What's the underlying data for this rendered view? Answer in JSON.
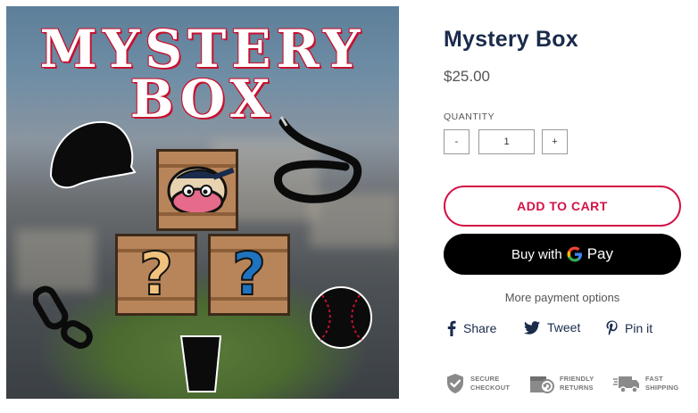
{
  "image": {
    "title_line1": "MYSTERY",
    "title_line2": "BOX",
    "crate_left_mark": "?",
    "crate_right_mark": "?",
    "crate_left_mark_color": "#f1c27d",
    "crate_right_mark_color": "#1e73be",
    "items": [
      "cap-icon",
      "lanyard-icon",
      "oyster-mascot-icon",
      "carabiner-icon",
      "cup-icon",
      "baseball-icon"
    ]
  },
  "product": {
    "title": "Mystery Box",
    "price": "$25.00"
  },
  "quantity": {
    "label": "QUANTITY",
    "minus": "-",
    "value": "1",
    "plus": "+"
  },
  "actions": {
    "add_to_cart": "ADD TO CART",
    "gpay_prefix": "Buy with",
    "gpay_word": "Pay",
    "more_payment": "More payment options"
  },
  "share": {
    "facebook": "Share",
    "twitter": "Tweet",
    "pinterest": "Pin it"
  },
  "badges": {
    "secure_line1": "Secure",
    "secure_line2": "Checkout",
    "returns_line1": "Friendly",
    "returns_line2": "Returns",
    "shipping_line1": "Fast",
    "shipping_line2": "Shipping"
  },
  "colors": {
    "title_navy": "#1a2b4c",
    "accent_red": "#d31145",
    "gpay_black": "#000000"
  }
}
